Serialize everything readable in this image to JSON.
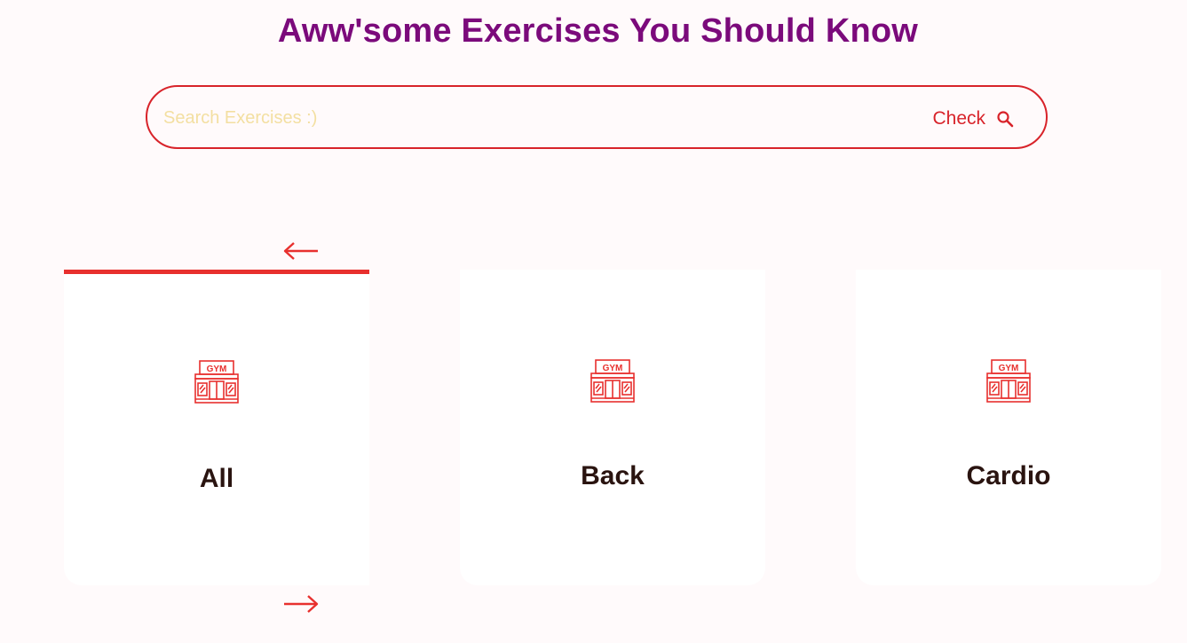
{
  "header": {
    "title": "Aww'some Exercises You Should Know"
  },
  "search": {
    "placeholder": "Search Exercises :)",
    "value": "",
    "button_label": "Check",
    "button_icon": "search-icon"
  },
  "carousel": {
    "prev_icon": "arrow-left-icon",
    "next_icon": "arrow-right-icon",
    "items": [
      {
        "label": "All",
        "icon": "gym-icon",
        "selected": true
      },
      {
        "label": "Back",
        "icon": "gym-icon",
        "selected": false
      },
      {
        "label": "Cardio",
        "icon": "gym-icon",
        "selected": false
      }
    ]
  },
  "colors": {
    "title": "#7b0a7b",
    "accent": "#d8232a",
    "placeholder": "#f3dfa1",
    "card_text": "#2a1410",
    "background": "#fffafb"
  }
}
